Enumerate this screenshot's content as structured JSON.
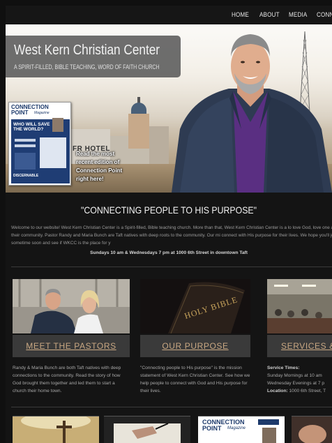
{
  "nav": {
    "items": [
      "HOME",
      "ABOUT",
      "MEDIA",
      "CONN"
    ]
  },
  "hero": {
    "title": "West Kern Christian Center",
    "tagline": "A SPIRIT-FILLED, BIBLE TEACHING, WORD OF FAITH CHURCH",
    "hotel_sign": "FR HOTEL",
    "magazine": {
      "name_line1": "CONNECTION",
      "name_line2": "POINT",
      "name_sub": "Magazine",
      "cover_headline": "WHO WILL SAVE THE WORLD?",
      "cover_footer": "DISCERNABLE",
      "caption": "Read the most recent edition of Connection Point right here!"
    }
  },
  "mission": {
    "title": "\"CONNECTING PEOPLE TO HIS PURPOSE\"",
    "welcome": "Welcome to our website! West Kern Christian Center is a Spirit-filled, Bible teaching church. More than that, West Kern Christian Center is a lo love God, love one another, and love their community. Pastor Randy and Maria Bunch are Taft natives with deep roots to the community. Our mi connect with His purpose for their lives. We hope you'll join us for a service sometime soon and see if WKCC is the place for y",
    "times": "Sundays 10 am & Wednesdays 7 pm at 1000 6th Street in downtown Taft"
  },
  "cards": [
    {
      "button": "MEET THE PASTORS",
      "text": "Randy & Maria Bunch are both Taft natives with deep connections to the community. Read the story of how God brought them together and led them to start a church their home town."
    },
    {
      "button": "OUR PURPOSE",
      "bible_text": "HOLY BIBLE",
      "text": "\"Connecting people to His purpose\" is the mission statement of West Kern Christian Center. See how we help people to connect with God and His purpose for their lives."
    },
    {
      "button": "SERVICES &",
      "heading": "Service Times:",
      "line1": "Sunday Mornings at 10 am",
      "line2": "Wednesday Evenings at 7 p",
      "location_label": "Location:",
      "location": "1000 6th Street, T"
    }
  ],
  "bottom_magazine": {
    "line1": "CONNECTION",
    "line2": "POINT",
    "sub": "Magazine"
  },
  "colors": {
    "background": "#141414",
    "button_bg": "#3a3a3a",
    "button_text": "#c9a883",
    "title_box": "#5a5a5a"
  }
}
